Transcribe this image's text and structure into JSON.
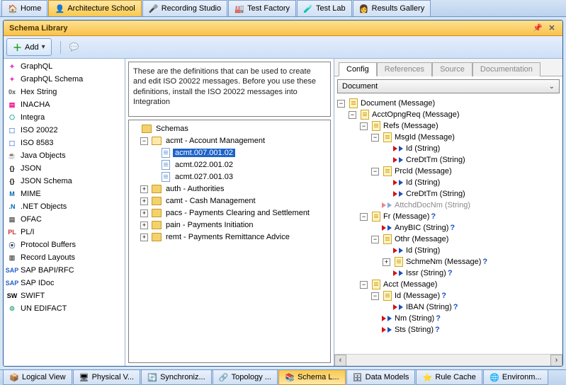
{
  "topTabs": [
    {
      "label": "Home"
    },
    {
      "label": "Architecture School"
    },
    {
      "label": "Recording Studio"
    },
    {
      "label": "Test Factory"
    },
    {
      "label": "Test Lab"
    },
    {
      "label": "Results Gallery"
    }
  ],
  "panel": {
    "title": "Schema Library",
    "addLabel": "Add"
  },
  "schemaList": [
    {
      "label": "GraphQL",
      "icon": "gql"
    },
    {
      "label": "GraphQL Schema",
      "icon": "gqls"
    },
    {
      "label": "Hex String",
      "icon": "hex"
    },
    {
      "label": "INACHA",
      "icon": "ina"
    },
    {
      "label": "Integra",
      "icon": "int"
    },
    {
      "label": "ISO 20022",
      "icon": "iso"
    },
    {
      "label": "ISO 8583",
      "icon": "iso"
    },
    {
      "label": "Java Objects",
      "icon": "java"
    },
    {
      "label": "JSON",
      "icon": "json"
    },
    {
      "label": "JSON Schema",
      "icon": "json"
    },
    {
      "label": "MIME",
      "icon": "mime"
    },
    {
      "label": ".NET Objects",
      "icon": "net"
    },
    {
      "label": "OFAC",
      "icon": "ofac"
    },
    {
      "label": "PL/I",
      "icon": "pli"
    },
    {
      "label": "Protocol Buffers",
      "icon": "pb"
    },
    {
      "label": "Record Layouts",
      "icon": "rec"
    },
    {
      "label": "SAP BAPI/RFC",
      "icon": "sap"
    },
    {
      "label": "SAP IDoc",
      "icon": "sap"
    },
    {
      "label": "SWIFT",
      "icon": "swift"
    },
    {
      "label": "UN EDIFACT",
      "icon": "un"
    }
  ],
  "description": "These are the definitions that can be used to create and edit ISO 20022 messages. Before you use these definitions, install the ISO 20022 messages into Integration",
  "schemaTree": {
    "root": "Schemas",
    "acmt": {
      "folder": "acmt - Account Management",
      "files": [
        "acmt.007.001.02",
        "acmt.022.001.02",
        "acmt.027.001.03"
      ],
      "selected": 0
    },
    "folders": [
      "auth - Authorities",
      "camt - Cash Management",
      "pacs - Payments Clearing and Settlement",
      "pain - Payments Initiation",
      "remt - Payments Remittance Advice"
    ]
  },
  "detailTabs": [
    "Config",
    "References",
    "Source",
    "Documentation"
  ],
  "docSelect": "Document",
  "docTree": [
    {
      "depth": 0,
      "toggle": "-",
      "icon": "yp",
      "text": "Document (Message)"
    },
    {
      "depth": 1,
      "toggle": "-",
      "icon": "yp",
      "text": "AcctOpngReq (Message)"
    },
    {
      "depth": 2,
      "toggle": "-",
      "icon": "yp",
      "text": "Refs (Message)"
    },
    {
      "depth": 3,
      "toggle": "-",
      "icon": "yp",
      "text": "MsgId (Message)"
    },
    {
      "depth": 4,
      "toggle": " ",
      "icon": "rf",
      "text": "Id (String)"
    },
    {
      "depth": 4,
      "toggle": " ",
      "icon": "rf",
      "text": "CreDtTm (String)"
    },
    {
      "depth": 3,
      "toggle": "-",
      "icon": "yp",
      "text": "PrcId (Message)"
    },
    {
      "depth": 4,
      "toggle": " ",
      "icon": "rf",
      "text": "Id (String)"
    },
    {
      "depth": 4,
      "toggle": " ",
      "icon": "rf",
      "text": "CreDtTm (String)"
    },
    {
      "depth": 3,
      "toggle": " ",
      "icon": "gr",
      "text": "AttchdDocNm (String)"
    },
    {
      "depth": 2,
      "toggle": "-",
      "icon": "yp",
      "text": "Fr (Message)",
      "opt": true
    },
    {
      "depth": 3,
      "toggle": " ",
      "icon": "rf",
      "text": "AnyBIC (String)",
      "opt": true
    },
    {
      "depth": 3,
      "toggle": "-",
      "icon": "yp",
      "text": "Othr (Message)"
    },
    {
      "depth": 4,
      "toggle": " ",
      "icon": "rf",
      "text": "Id (String)"
    },
    {
      "depth": 4,
      "toggle": "+",
      "icon": "yp",
      "text": "SchmeNm (Message)",
      "opt": true
    },
    {
      "depth": 4,
      "toggle": " ",
      "icon": "rf",
      "text": "Issr (String)",
      "opt": true
    },
    {
      "depth": 2,
      "toggle": "-",
      "icon": "yp",
      "text": "Acct (Message)"
    },
    {
      "depth": 3,
      "toggle": "-",
      "icon": "yp",
      "text": "Id (Message)",
      "opt": true
    },
    {
      "depth": 4,
      "toggle": " ",
      "icon": "rf",
      "text": "IBAN (String)",
      "opt": true
    },
    {
      "depth": 3,
      "toggle": " ",
      "icon": "rf",
      "text": "Nm (String)",
      "opt": true
    },
    {
      "depth": 3,
      "toggle": " ",
      "icon": "rf",
      "text": "Sts (String)",
      "opt": true
    }
  ],
  "bottomTabs": [
    {
      "label": "Logical View"
    },
    {
      "label": "Physical V..."
    },
    {
      "label": "Synchroniz..."
    },
    {
      "label": "Topology ..."
    },
    {
      "label": "Schema L...",
      "active": true
    },
    {
      "label": "Data Models"
    },
    {
      "label": "Rule Cache"
    },
    {
      "label": "Environm..."
    }
  ]
}
